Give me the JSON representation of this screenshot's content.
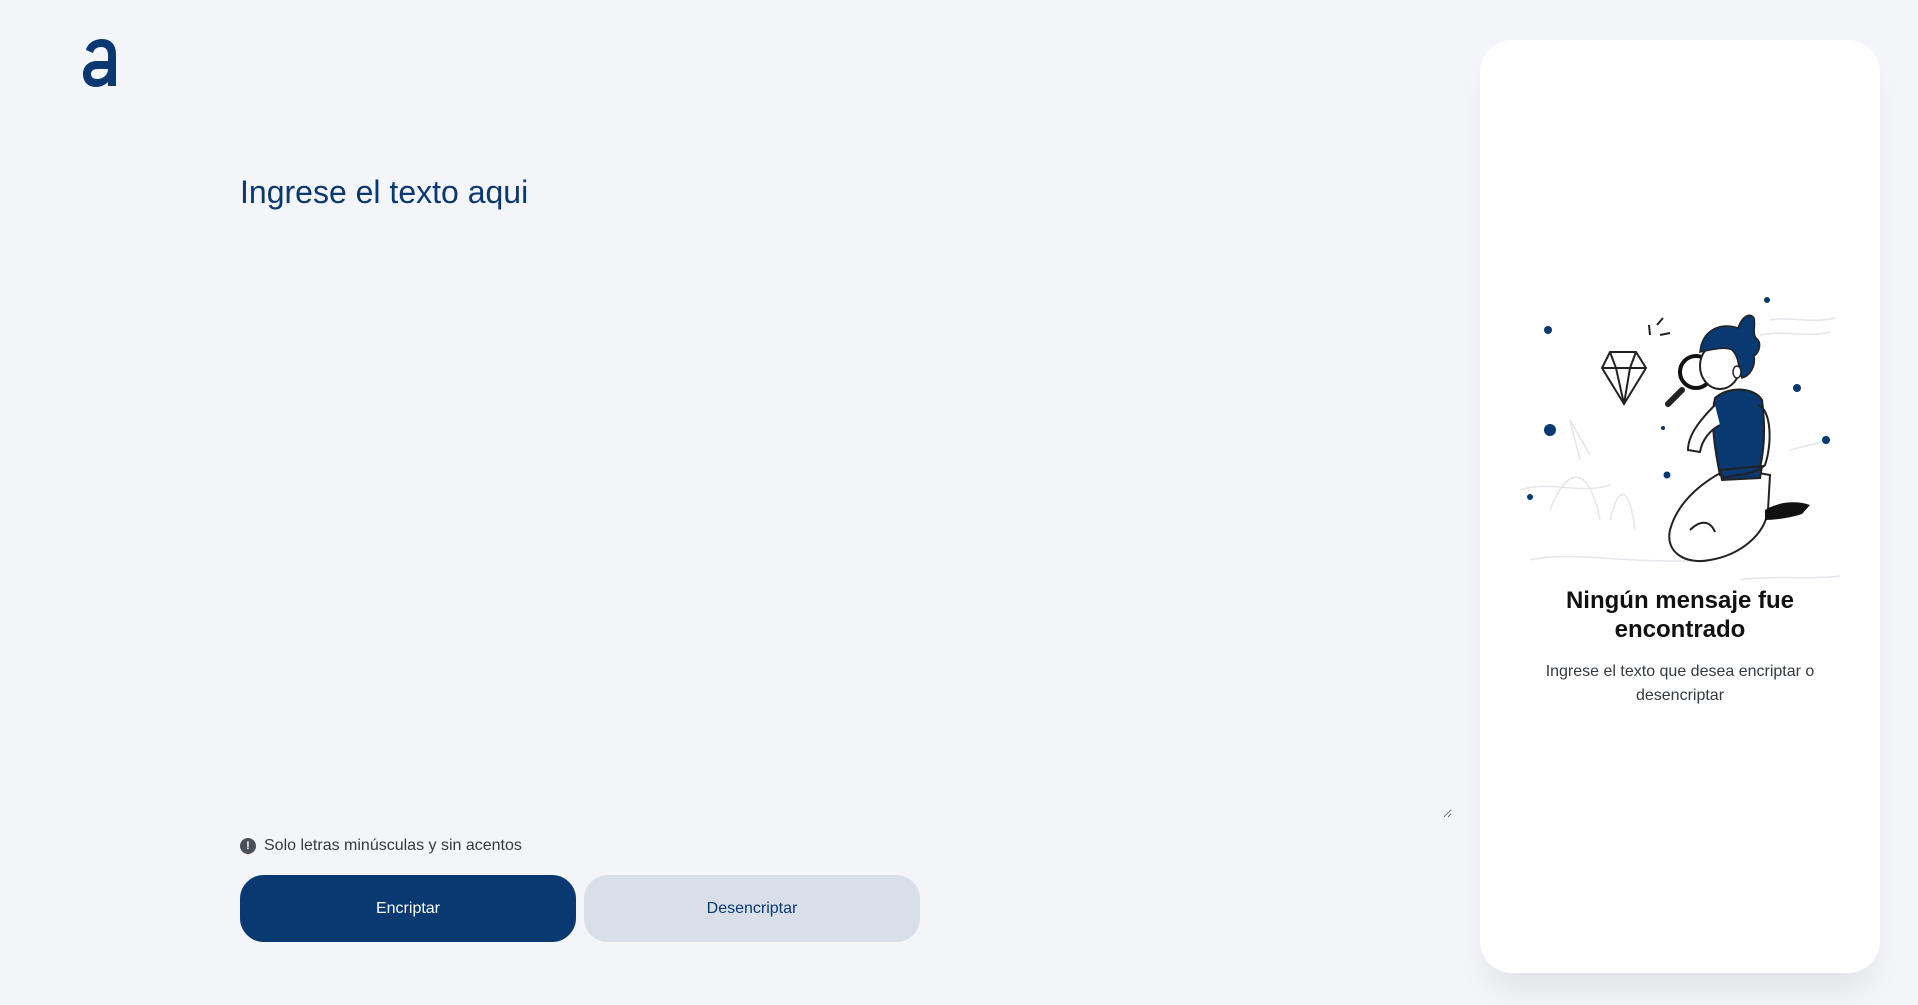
{
  "app": {
    "logo_text": "a"
  },
  "input": {
    "placeholder": "Ingrese el texto aqui",
    "value": ""
  },
  "hint": {
    "icon": "exclamation-circle-icon",
    "text": "Solo letras minúsculas y sin acentos"
  },
  "buttons": {
    "encrypt_label": "Encriptar",
    "decrypt_label": "Desencriptar"
  },
  "output_panel": {
    "illustration": "man-with-magnifier-and-diamond",
    "title": "Ningún mensaje fue encontrado",
    "text": "Ingrese el texto que desea encriptar o desencriptar"
  },
  "colors": {
    "primary": "#0a3871",
    "secondary": "#d8dfe8",
    "background": "#f3f5f8",
    "panel": "#ffffff"
  }
}
